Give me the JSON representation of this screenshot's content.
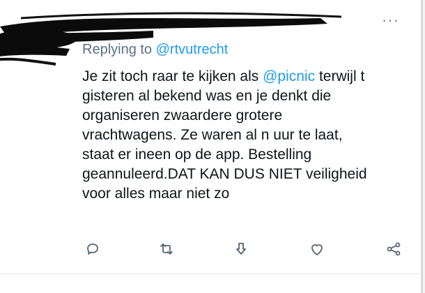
{
  "tweet": {
    "more_label": "···",
    "reply_prefix": "Replying to ",
    "reply_handle": "@rtvutrecht",
    "lines": {
      "l1a": "Je zit toch raar te kijken als ",
      "l1_mention": "@picnic",
      "l1b": " terwijl t",
      "l2": "gisteren al bekend was en je denkt die",
      "l3": "organiseren zwaardere grotere",
      "l4": "vrachtwagens. Ze waren al n uur te laat,",
      "l5": "staat er ineen op de app. Bestelling",
      "l6": "geannuleerd.DAT KAN DUS NIET veiligheid",
      "l7": "voor alles maar niet zo"
    }
  },
  "actions": {
    "icons": [
      "reply-icon",
      "retweet-icon",
      "share-download-icon",
      "like-icon",
      "share-icon"
    ]
  },
  "colors": {
    "accent": "#1d9bf0",
    "secondary_text": "#5b7083",
    "icon": "#536471"
  }
}
